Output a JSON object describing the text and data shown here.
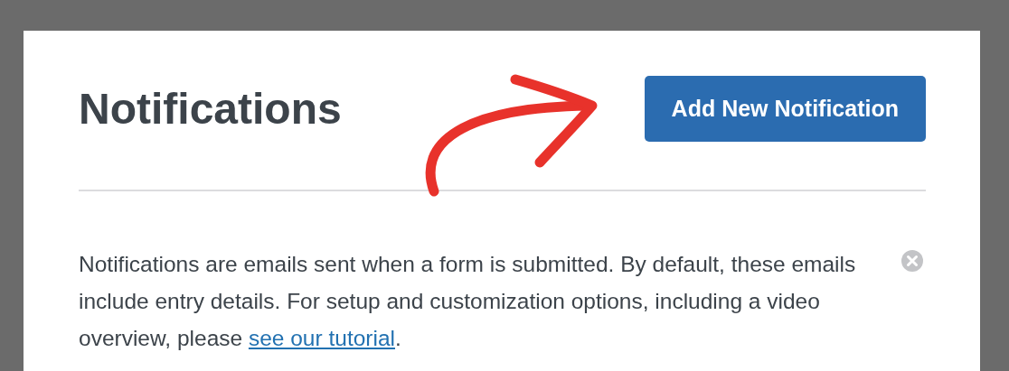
{
  "title": "Notifications",
  "add_button": {
    "label": "Add New Notification"
  },
  "notice": {
    "text": "Notifications are emails sent when a form is submitted. By default, these emails include entry details. For setup and customization options, including a video overview, please ",
    "link": "see our tutorial",
    "after": "."
  }
}
